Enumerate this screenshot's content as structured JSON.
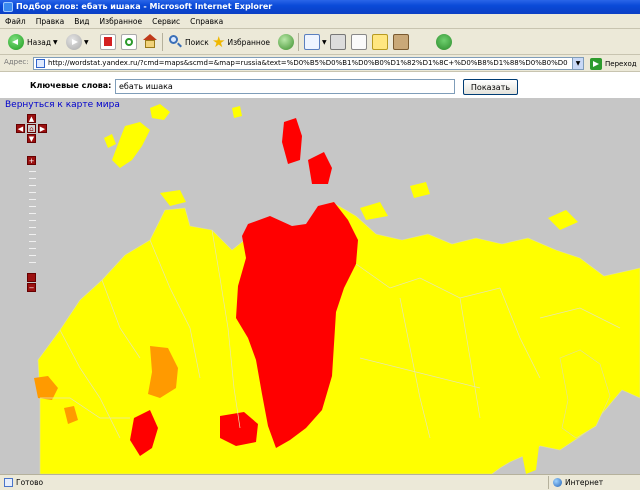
{
  "window": {
    "title": "Подбор слов: ебать ишака - Microsoft Internet Explorer"
  },
  "menu": [
    "Файл",
    "Правка",
    "Вид",
    "Избранное",
    "Сервис",
    "Справка"
  ],
  "toolbar": {
    "back_label": "Назад",
    "search_label": "Поиск",
    "favorites_label": "Избранное"
  },
  "address": {
    "label": "Адрес:",
    "url": "http://wordstat.yandex.ru/?cmd=maps&scmd=&map=russia&text=%D0%B5%D0%B1%D0%B0%D1%82%D1%8C+%D0%B8%D1%88%D0%B0%D0%BA%D0",
    "go_label": "Переход"
  },
  "search": {
    "label": "Ключевые слова:",
    "value": "ебать ишака",
    "button": "Показать"
  },
  "map": {
    "back_link": "Вернуться к карте мира",
    "colors": {
      "background": "#c6c6c6",
      "low": "#ffff00",
      "medium": "#ff9a00",
      "high": "#ff0000"
    }
  },
  "status": {
    "text": "Готово",
    "zone": "Интернет"
  }
}
